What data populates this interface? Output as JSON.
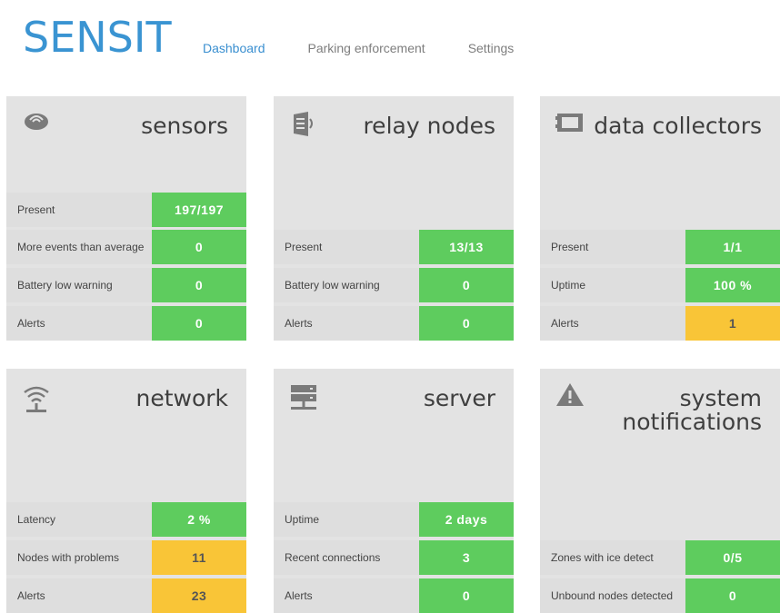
{
  "app": {
    "logo": "SENSIT",
    "nav": [
      "Dashboard",
      "Parking enforcement",
      "Settings"
    ],
    "active_nav": "Dashboard"
  },
  "colors": {
    "brand": "#3a94d2",
    "ok": "#5ecc5e",
    "warning": "#f9c537",
    "card_bg": "#e3e3e3"
  },
  "cards": {
    "sensors": {
      "title": "sensors",
      "icon": "sensor-icon",
      "rows": [
        {
          "label": "Present",
          "value": "197/197",
          "status": "ok"
        },
        {
          "label": "More events than average",
          "value": "0",
          "status": "ok"
        },
        {
          "label": "Battery low warning",
          "value": "0",
          "status": "ok"
        },
        {
          "label": "Alerts",
          "value": "0",
          "status": "ok"
        }
      ]
    },
    "relay_nodes": {
      "title": "relay nodes",
      "icon": "relay-node-icon",
      "rows": [
        {
          "label": "Present",
          "value": "13/13",
          "status": "ok"
        },
        {
          "label": "Battery low warning",
          "value": "0",
          "status": "ok"
        },
        {
          "label": "Alerts",
          "value": "0",
          "status": "ok"
        }
      ]
    },
    "data_collectors": {
      "title": "data collectors",
      "icon": "data-collector-icon",
      "rows": [
        {
          "label": "Present",
          "value": "1/1",
          "status": "ok"
        },
        {
          "label": "Uptime",
          "value": "100 %",
          "status": "ok"
        },
        {
          "label": "Alerts",
          "value": "1",
          "status": "warning"
        }
      ]
    },
    "network": {
      "title": "network",
      "icon": "wifi-icon",
      "rows": [
        {
          "label": "Latency",
          "value": "2 %",
          "status": "ok"
        },
        {
          "label": "Nodes with problems",
          "value": "11",
          "status": "warning"
        },
        {
          "label": "Alerts",
          "value": "23",
          "status": "warning"
        }
      ]
    },
    "server": {
      "title": "server",
      "icon": "server-icon",
      "rows": [
        {
          "label": "Uptime",
          "value": "2 days",
          "status": "ok"
        },
        {
          "label": "Recent connections",
          "value": "3",
          "status": "ok"
        },
        {
          "label": "Alerts",
          "value": "0",
          "status": "ok"
        }
      ]
    },
    "system_notifications": {
      "title_line1": "system",
      "title_line2": "notifications",
      "icon": "warning-icon",
      "rows": [
        {
          "label": "Zones with ice detect",
          "value": "0/5",
          "status": "ok"
        },
        {
          "label": "Unbound nodes detected",
          "value": "0",
          "status": "ok"
        }
      ]
    }
  }
}
